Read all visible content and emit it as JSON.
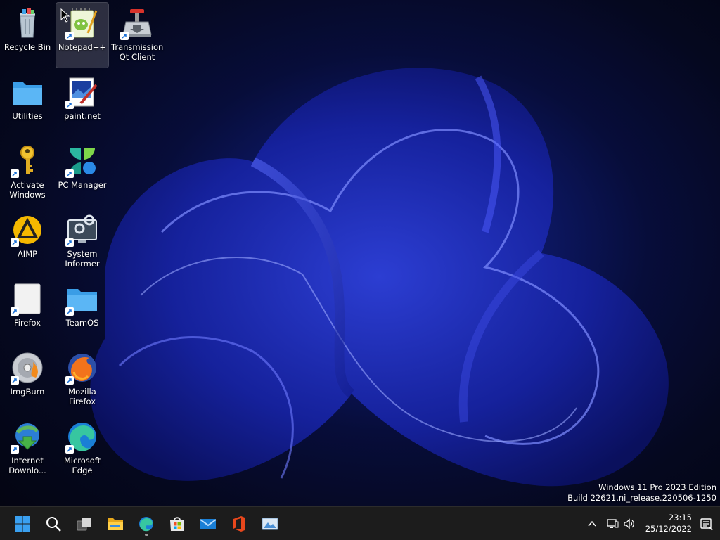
{
  "desktop": {
    "icons": [
      {
        "label": "Recycle Bin"
      },
      {
        "label": "Notepad++"
      },
      {
        "label": "Transmission Qt Client"
      },
      {
        "label": "Utilities"
      },
      {
        "label": "paint.net"
      },
      {
        "label": "Activate Windows"
      },
      {
        "label": "PC Manager"
      },
      {
        "label": "AIMP"
      },
      {
        "label": "System Informer"
      },
      {
        "label": "Firefox"
      },
      {
        "label": "TeamOS"
      },
      {
        "label": "ImgBurn"
      },
      {
        "label": "Mozilla Firefox"
      },
      {
        "label": "Internet Downlo..."
      },
      {
        "label": "Microsoft Edge"
      }
    ]
  },
  "watermark": {
    "line1": "Windows 11 Pro 2023 Edition",
    "line2": "Build 22621.ni_release.220506-1250"
  },
  "taskbar": {
    "pinned": [
      "start-icon",
      "search-icon",
      "task-view-icon",
      "file-explorer-icon",
      "edge-icon",
      "store-icon",
      "mail-icon",
      "office-icon",
      "photos-icon"
    ],
    "tray_icons": [
      "chevron-up-icon",
      "network-icon",
      "volume-icon",
      "notification-icon"
    ],
    "clock": {
      "time": "23:15",
      "date": "25/12/2022"
    }
  },
  "colors": {
    "taskbar_bg": "#1c1c1c",
    "wallpaper_accent": "#1a2a9a"
  }
}
